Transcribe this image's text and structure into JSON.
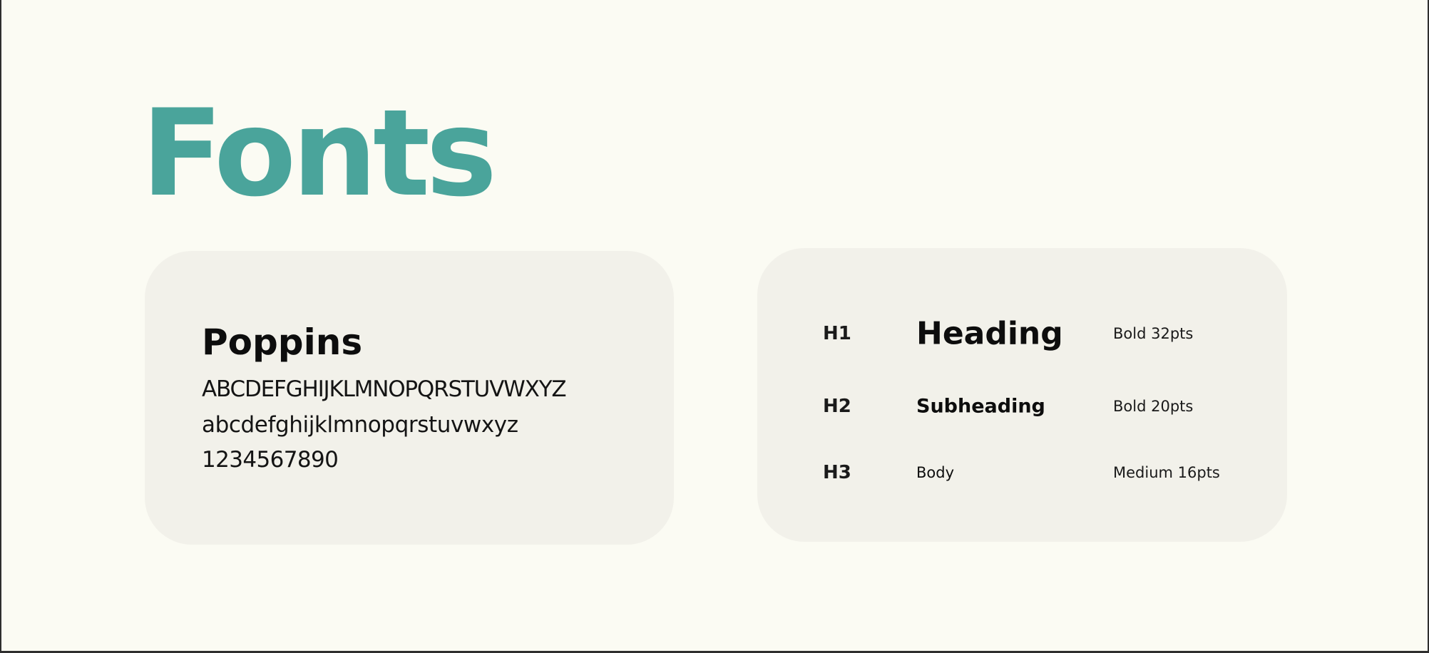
{
  "title": "Fonts",
  "font_card": {
    "name": "Poppins",
    "uppercase": "ABCDEFGHIJKLMNOPQRSTUVWXYZ",
    "lowercase": "abcdefghijklmnopqrstuvwxyz",
    "digits": "1234567890"
  },
  "type_scale": [
    {
      "level": "H1",
      "sample": "Heading",
      "spec": "Bold 32pts"
    },
    {
      "level": "H2",
      "sample": "Subheading",
      "spec": "Bold 20pts"
    },
    {
      "level": "H3",
      "sample": "Body",
      "spec": "Medium 16pts"
    }
  ],
  "colors": {
    "background": "#fbfbf3",
    "card": "#f2f1ea",
    "accent": "#4aa49b",
    "text": "#0d0d0d"
  }
}
